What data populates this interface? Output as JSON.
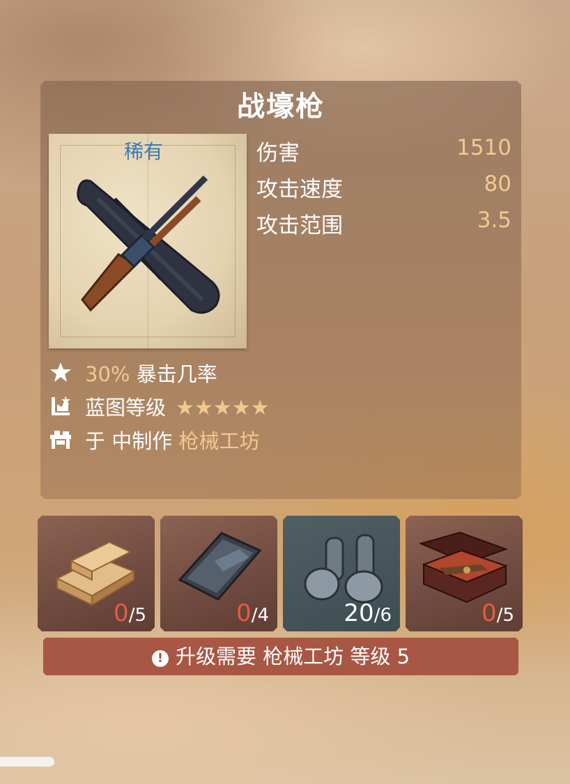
{
  "item": {
    "name": "战壕枪",
    "rarity": "稀有",
    "stats": [
      {
        "label": "伤害",
        "value": "1510"
      },
      {
        "label": "攻击速度",
        "value": "80"
      },
      {
        "label": "攻击范围",
        "value": "3.5"
      }
    ]
  },
  "info": {
    "crit_value": "30%",
    "crit_label": "暴击几率",
    "blueprint_label": "蓝图等级",
    "blueprint_stars": "★★★★★",
    "blueprint_level": 5,
    "craft_prefix": "于 中制作",
    "craft_place": "枪械工坊"
  },
  "materials": [
    {
      "icon": "wood-planks-icon",
      "have": "0",
      "need": "/5"
    },
    {
      "icon": "metal-ingot-icon",
      "have": "0",
      "need": "/4"
    },
    {
      "icon": "rivets-icon",
      "have": "20",
      "need": "/6"
    },
    {
      "icon": "weapon-parts-case-icon",
      "have": "0",
      "need": "/5"
    }
  ],
  "warning": {
    "text": "升级需要 枪械工坊 等级 5"
  },
  "colors": {
    "accent": "#f3c890",
    "rarity": "#3a7ab5",
    "missing": "#e75b40",
    "warning_bg": "#a75743"
  }
}
